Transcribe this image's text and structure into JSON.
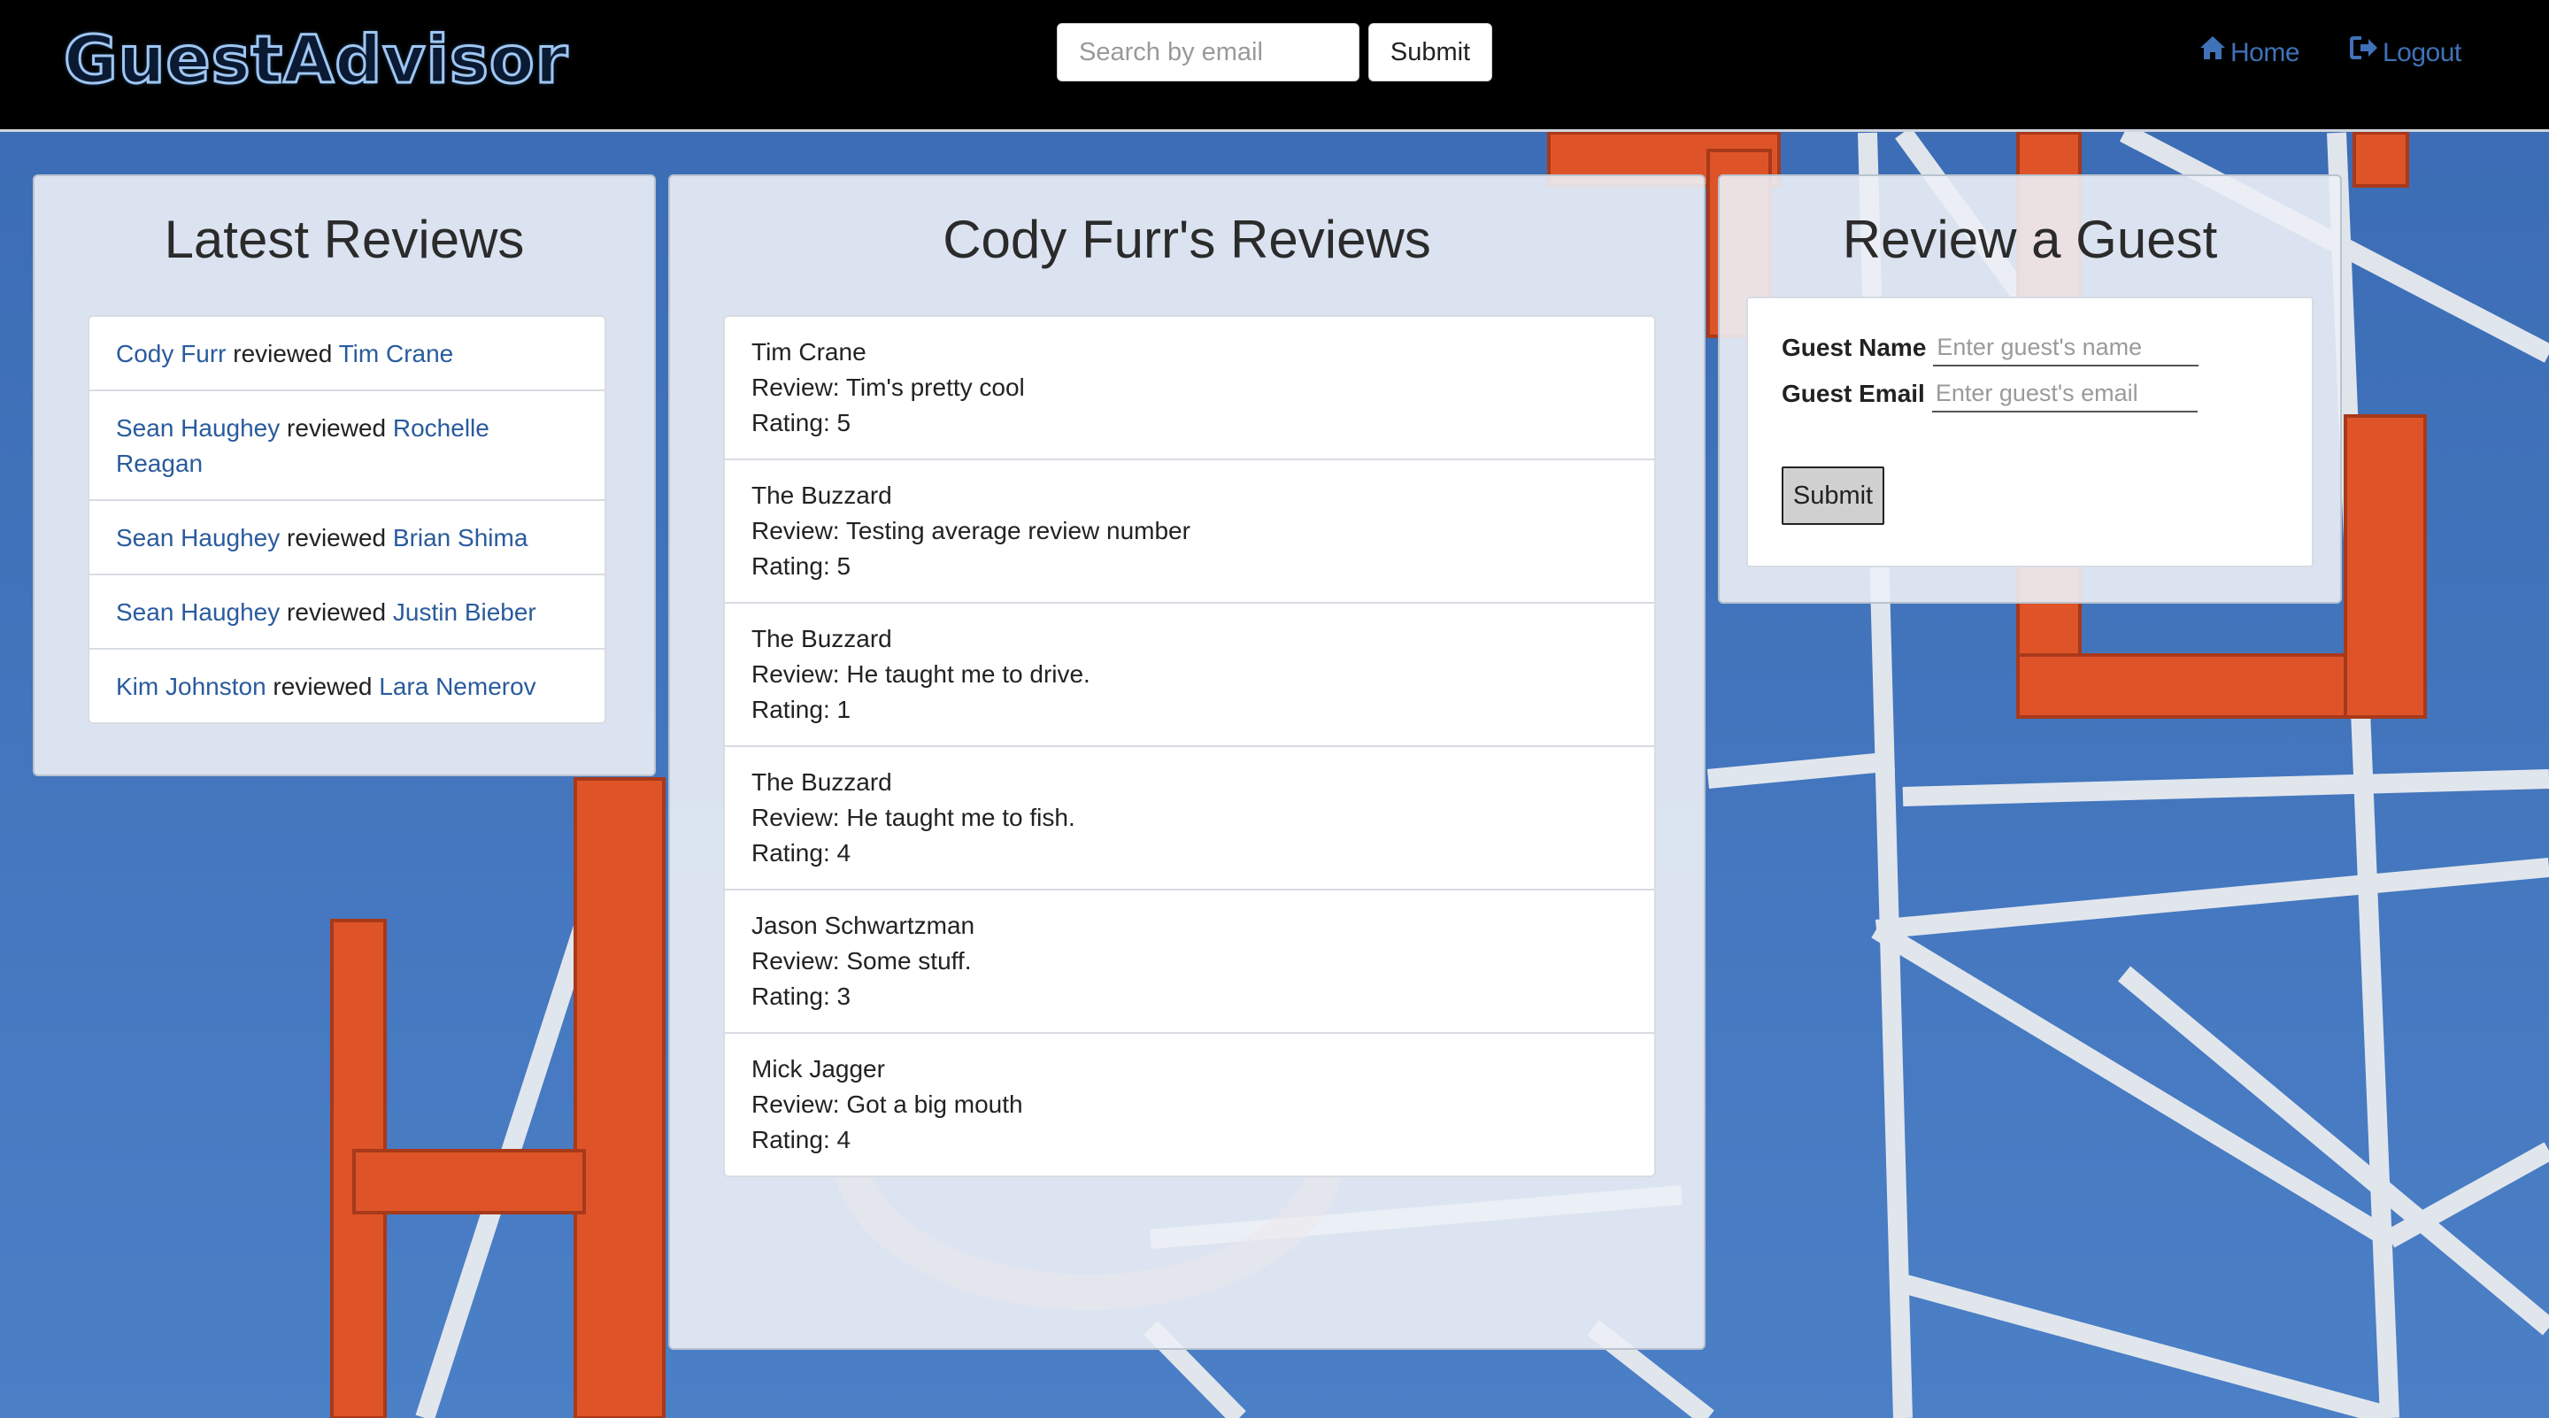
{
  "brand": "GuestAdvisor",
  "search": {
    "placeholder": "Search by email",
    "submit_label": "Submit"
  },
  "nav": {
    "home_label": "Home",
    "logout_label": "Logout"
  },
  "latest": {
    "title": "Latest Reviews",
    "items": [
      {
        "reviewer": "Cody Furr",
        "verb": "reviewed",
        "guest": "Tim Crane"
      },
      {
        "reviewer": "Sean Haughey",
        "verb": "reviewed",
        "guest": "Rochelle Reagan"
      },
      {
        "reviewer": "Sean Haughey",
        "verb": "reviewed",
        "guest": "Brian Shima"
      },
      {
        "reviewer": "Sean Haughey",
        "verb": "reviewed",
        "guest": "Justin Bieber"
      },
      {
        "reviewer": "Kim Johnston",
        "verb": "reviewed",
        "guest": "Lara Nemerov"
      }
    ]
  },
  "user_reviews": {
    "title": "Cody Furr's Reviews",
    "items": [
      {
        "guest": "Tim Crane",
        "review": "Review: Tim's pretty cool",
        "rating": "Rating: 5"
      },
      {
        "guest": "The Buzzard",
        "review": "Review: Testing average review number",
        "rating": "Rating: 5"
      },
      {
        "guest": "The Buzzard",
        "review": "Review: He taught me to drive.",
        "rating": "Rating: 1"
      },
      {
        "guest": "The Buzzard",
        "review": "Review: He taught me to fish.",
        "rating": "Rating: 4"
      },
      {
        "guest": "Jason Schwartzman",
        "review": "Review: Some stuff.",
        "rating": "Rating: 3"
      },
      {
        "guest": "Mick Jagger",
        "review": "Review: Got a big mouth",
        "rating": "Rating: 4"
      }
    ]
  },
  "review_form": {
    "title": "Review a Guest",
    "name_label": "Guest Name",
    "name_placeholder": "Enter guest's name",
    "email_label": "Guest Email",
    "email_placeholder": "Enter guest's email",
    "submit_label": "Submit"
  },
  "colors": {
    "navbar": "#000000",
    "link": "#2a5b9d",
    "nav_link": "#3f72b8",
    "sky": "#4a7dc5",
    "sign": "#e0572b"
  },
  "icons": {
    "home": "home-icon",
    "logout": "logout-icon"
  }
}
